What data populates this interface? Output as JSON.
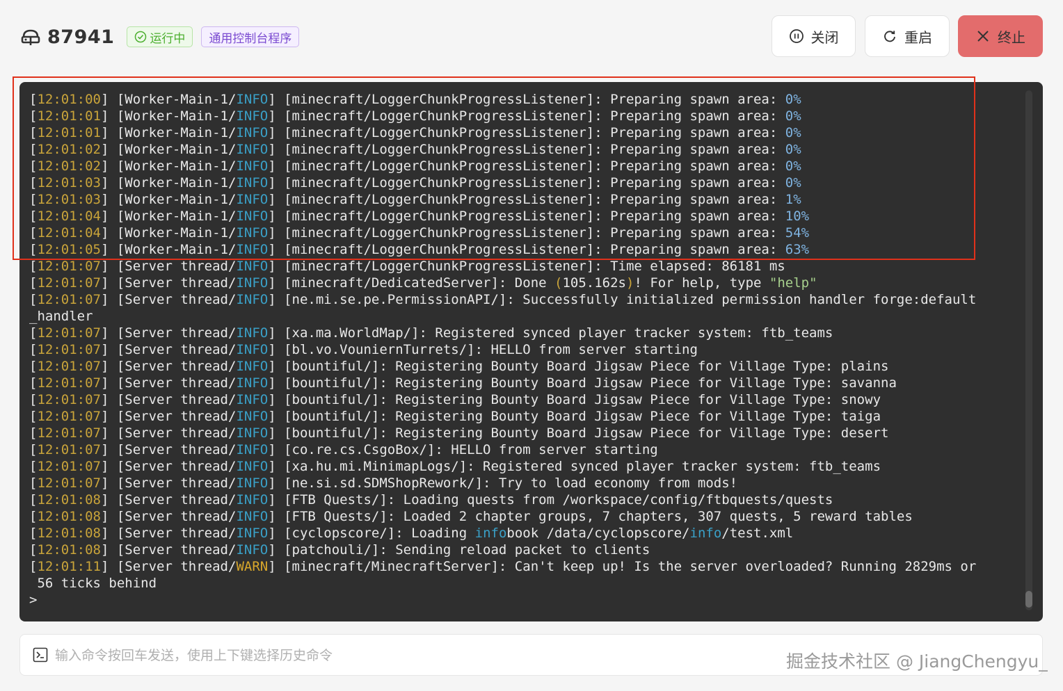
{
  "header": {
    "title": "87941",
    "status": "运行中",
    "type": "通用控制台程序",
    "buttons": {
      "close": "关闭",
      "restart": "重启",
      "stop": "终止"
    }
  },
  "colors": {
    "timestamp": "#c9a43a",
    "info": "#3aa0c7",
    "warn": "#d8a72b",
    "stop_button": "#e36c6c",
    "highlight": "#e0311b"
  },
  "console": {
    "lines": [
      [
        {
          "t": "[",
          "c": ""
        },
        {
          "t": "12:01:00",
          "c": "ts"
        },
        {
          "t": "] [Worker-Main-1/",
          "c": ""
        },
        {
          "t": "INFO",
          "c": "info"
        },
        {
          "t": "] [minecraft/LoggerChunkProgressListener]: Preparing spawn area: ",
          "c": ""
        },
        {
          "t": "0%",
          "c": "num"
        }
      ],
      [
        {
          "t": "[",
          "c": ""
        },
        {
          "t": "12:01:01",
          "c": "ts"
        },
        {
          "t": "] [Worker-Main-1/",
          "c": ""
        },
        {
          "t": "INFO",
          "c": "info"
        },
        {
          "t": "] [minecraft/LoggerChunkProgressListener]: Preparing spawn area: ",
          "c": ""
        },
        {
          "t": "0%",
          "c": "num"
        }
      ],
      [
        {
          "t": "[",
          "c": ""
        },
        {
          "t": "12:01:01",
          "c": "ts"
        },
        {
          "t": "] [Worker-Main-1/",
          "c": ""
        },
        {
          "t": "INFO",
          "c": "info"
        },
        {
          "t": "] [minecraft/LoggerChunkProgressListener]: Preparing spawn area: ",
          "c": ""
        },
        {
          "t": "0%",
          "c": "num"
        }
      ],
      [
        {
          "t": "[",
          "c": ""
        },
        {
          "t": "12:01:02",
          "c": "ts"
        },
        {
          "t": "] [Worker-Main-1/",
          "c": ""
        },
        {
          "t": "INFO",
          "c": "info"
        },
        {
          "t": "] [minecraft/LoggerChunkProgressListener]: Preparing spawn area: ",
          "c": ""
        },
        {
          "t": "0%",
          "c": "num"
        }
      ],
      [
        {
          "t": "[",
          "c": ""
        },
        {
          "t": "12:01:02",
          "c": "ts"
        },
        {
          "t": "] [Worker-Main-1/",
          "c": ""
        },
        {
          "t": "INFO",
          "c": "info"
        },
        {
          "t": "] [minecraft/LoggerChunkProgressListener]: Preparing spawn area: ",
          "c": ""
        },
        {
          "t": "0%",
          "c": "num"
        }
      ],
      [
        {
          "t": "[",
          "c": ""
        },
        {
          "t": "12:01:03",
          "c": "ts"
        },
        {
          "t": "] [Worker-Main-1/",
          "c": ""
        },
        {
          "t": "INFO",
          "c": "info"
        },
        {
          "t": "] [minecraft/LoggerChunkProgressListener]: Preparing spawn area: ",
          "c": ""
        },
        {
          "t": "0%",
          "c": "num"
        }
      ],
      [
        {
          "t": "[",
          "c": ""
        },
        {
          "t": "12:01:03",
          "c": "ts"
        },
        {
          "t": "] [Worker-Main-1/",
          "c": ""
        },
        {
          "t": "INFO",
          "c": "info"
        },
        {
          "t": "] [minecraft/LoggerChunkProgressListener]: Preparing spawn area: ",
          "c": ""
        },
        {
          "t": "1%",
          "c": "num"
        }
      ],
      [
        {
          "t": "[",
          "c": ""
        },
        {
          "t": "12:01:04",
          "c": "ts"
        },
        {
          "t": "] [Worker-Main-1/",
          "c": ""
        },
        {
          "t": "INFO",
          "c": "info"
        },
        {
          "t": "] [minecraft/LoggerChunkProgressListener]: Preparing spawn area: ",
          "c": ""
        },
        {
          "t": "10%",
          "c": "num"
        }
      ],
      [
        {
          "t": "[",
          "c": ""
        },
        {
          "t": "12:01:04",
          "c": "ts"
        },
        {
          "t": "] [Worker-Main-1/",
          "c": ""
        },
        {
          "t": "INFO",
          "c": "info"
        },
        {
          "t": "] [minecraft/LoggerChunkProgressListener]: Preparing spawn area: ",
          "c": ""
        },
        {
          "t": "54%",
          "c": "num"
        }
      ],
      [
        {
          "t": "[",
          "c": ""
        },
        {
          "t": "12:01:05",
          "c": "ts"
        },
        {
          "t": "] [Worker-Main-1/",
          "c": ""
        },
        {
          "t": "INFO",
          "c": "info"
        },
        {
          "t": "] [minecraft/LoggerChunkProgressListener]: Preparing spawn area: ",
          "c": ""
        },
        {
          "t": "63%",
          "c": "num"
        }
      ],
      [
        {
          "t": "[",
          "c": ""
        },
        {
          "t": "12:01:07",
          "c": "ts"
        },
        {
          "t": "] [Server thread/",
          "c": ""
        },
        {
          "t": "INFO",
          "c": "info"
        },
        {
          "t": "] [minecraft/LoggerChunkProgressListener]: Time elapsed: 86181 ms",
          "c": ""
        }
      ],
      [
        {
          "t": "[",
          "c": ""
        },
        {
          "t": "12:01:07",
          "c": "ts"
        },
        {
          "t": "] [Server thread/",
          "c": ""
        },
        {
          "t": "INFO",
          "c": "info"
        },
        {
          "t": "] [minecraft/DedicatedServer]: Done ",
          "c": ""
        },
        {
          "t": "(",
          "c": "ts"
        },
        {
          "t": "105.162s",
          "c": ""
        },
        {
          "t": ")",
          "c": "ts"
        },
        {
          "t": "! For help, type ",
          "c": ""
        },
        {
          "t": "\"help\"",
          "c": "str"
        }
      ],
      [
        {
          "t": "[",
          "c": ""
        },
        {
          "t": "12:01:07",
          "c": "ts"
        },
        {
          "t": "] [Server thread/",
          "c": ""
        },
        {
          "t": "INFO",
          "c": "info"
        },
        {
          "t": "] [ne.mi.se.pe.PermissionAPI/]: Successfully initialized permission handler forge:default",
          "c": ""
        }
      ],
      [
        {
          "t": "_handler",
          "c": ""
        }
      ],
      [
        {
          "t": "[",
          "c": ""
        },
        {
          "t": "12:01:07",
          "c": "ts"
        },
        {
          "t": "] [Server thread/",
          "c": ""
        },
        {
          "t": "INFO",
          "c": "info"
        },
        {
          "t": "] [xa.ma.WorldMap/]: Registered synced player tracker system: ftb_teams",
          "c": ""
        }
      ],
      [
        {
          "t": "[",
          "c": ""
        },
        {
          "t": "12:01:07",
          "c": "ts"
        },
        {
          "t": "] [Server thread/",
          "c": ""
        },
        {
          "t": "INFO",
          "c": "info"
        },
        {
          "t": "] [bl.vo.VouniernTurrets/]: HELLO from server starting",
          "c": ""
        }
      ],
      [
        {
          "t": "[",
          "c": ""
        },
        {
          "t": "12:01:07",
          "c": "ts"
        },
        {
          "t": "] [Server thread/",
          "c": ""
        },
        {
          "t": "INFO",
          "c": "info"
        },
        {
          "t": "] [bountiful/]: Registering Bounty Board Jigsaw Piece for Village Type: plains",
          "c": ""
        }
      ],
      [
        {
          "t": "[",
          "c": ""
        },
        {
          "t": "12:01:07",
          "c": "ts"
        },
        {
          "t": "] [Server thread/",
          "c": ""
        },
        {
          "t": "INFO",
          "c": "info"
        },
        {
          "t": "] [bountiful/]: Registering Bounty Board Jigsaw Piece for Village Type: savanna",
          "c": ""
        }
      ],
      [
        {
          "t": "[",
          "c": ""
        },
        {
          "t": "12:01:07",
          "c": "ts"
        },
        {
          "t": "] [Server thread/",
          "c": ""
        },
        {
          "t": "INFO",
          "c": "info"
        },
        {
          "t": "] [bountiful/]: Registering Bounty Board Jigsaw Piece for Village Type: snowy",
          "c": ""
        }
      ],
      [
        {
          "t": "[",
          "c": ""
        },
        {
          "t": "12:01:07",
          "c": "ts"
        },
        {
          "t": "] [Server thread/",
          "c": ""
        },
        {
          "t": "INFO",
          "c": "info"
        },
        {
          "t": "] [bountiful/]: Registering Bounty Board Jigsaw Piece for Village Type: taiga",
          "c": ""
        }
      ],
      [
        {
          "t": "[",
          "c": ""
        },
        {
          "t": "12:01:07",
          "c": "ts"
        },
        {
          "t": "] [Server thread/",
          "c": ""
        },
        {
          "t": "INFO",
          "c": "info"
        },
        {
          "t": "] [bountiful/]: Registering Bounty Board Jigsaw Piece for Village Type: desert",
          "c": ""
        }
      ],
      [
        {
          "t": "[",
          "c": ""
        },
        {
          "t": "12:01:07",
          "c": "ts"
        },
        {
          "t": "] [Server thread/",
          "c": ""
        },
        {
          "t": "INFO",
          "c": "info"
        },
        {
          "t": "] [co.re.cs.CsgoBox/]: HELLO from server starting",
          "c": ""
        }
      ],
      [
        {
          "t": "[",
          "c": ""
        },
        {
          "t": "12:01:07",
          "c": "ts"
        },
        {
          "t": "] [Server thread/",
          "c": ""
        },
        {
          "t": "INFO",
          "c": "info"
        },
        {
          "t": "] [xa.hu.mi.MinimapLogs/]: Registered synced player tracker system: ftb_teams",
          "c": ""
        }
      ],
      [
        {
          "t": "[",
          "c": ""
        },
        {
          "t": "12:01:07",
          "c": "ts"
        },
        {
          "t": "] [Server thread/",
          "c": ""
        },
        {
          "t": "INFO",
          "c": "info"
        },
        {
          "t": "] [ne.si.sd.SDMShopRework/]: Try to load economy from mods!",
          "c": ""
        }
      ],
      [
        {
          "t": "[",
          "c": ""
        },
        {
          "t": "12:01:08",
          "c": "ts"
        },
        {
          "t": "] [Server thread/",
          "c": ""
        },
        {
          "t": "INFO",
          "c": "info"
        },
        {
          "t": "] [FTB Quests/]: Loading quests from /workspace/config/ftbquests/quests",
          "c": ""
        }
      ],
      [
        {
          "t": "[",
          "c": ""
        },
        {
          "t": "12:01:08",
          "c": "ts"
        },
        {
          "t": "] [Server thread/",
          "c": ""
        },
        {
          "t": "INFO",
          "c": "info"
        },
        {
          "t": "] [FTB Quests/]: Loaded 2 chapter groups, 7 chapters, 307 quests, 5 reward tables",
          "c": ""
        }
      ],
      [
        {
          "t": "[",
          "c": ""
        },
        {
          "t": "12:01:08",
          "c": "ts"
        },
        {
          "t": "] [Server thread/",
          "c": ""
        },
        {
          "t": "INFO",
          "c": "info"
        },
        {
          "t": "] [cyclopscore/]: Loading ",
          "c": ""
        },
        {
          "t": "info",
          "c": "info"
        },
        {
          "t": "book /data/cyclopscore/",
          "c": ""
        },
        {
          "t": "info",
          "c": "info"
        },
        {
          "t": "/test.xml",
          "c": ""
        }
      ],
      [
        {
          "t": "[",
          "c": ""
        },
        {
          "t": "12:01:08",
          "c": "ts"
        },
        {
          "t": "] [Server thread/",
          "c": ""
        },
        {
          "t": "INFO",
          "c": "info"
        },
        {
          "t": "] [patchouli/]: Sending reload packet to clients",
          "c": ""
        }
      ],
      [
        {
          "t": "[",
          "c": ""
        },
        {
          "t": "12:01:11",
          "c": "ts"
        },
        {
          "t": "] [Server thread/",
          "c": ""
        },
        {
          "t": "WARN",
          "c": "warn"
        },
        {
          "t": "] [minecraft/MinecraftServer]: Can't keep up! Is the server overloaded? Running 2829ms or",
          "c": ""
        }
      ],
      [
        {
          "t": " 56 ticks behind",
          "c": ""
        }
      ],
      [
        {
          "t": ">",
          "c": ""
        }
      ]
    ]
  },
  "command": {
    "placeholder": "输入命令按回车发送，使用上下键选择历史命令",
    "value": ""
  },
  "watermark": "掘金技术社区 @ JiangChengyu_"
}
